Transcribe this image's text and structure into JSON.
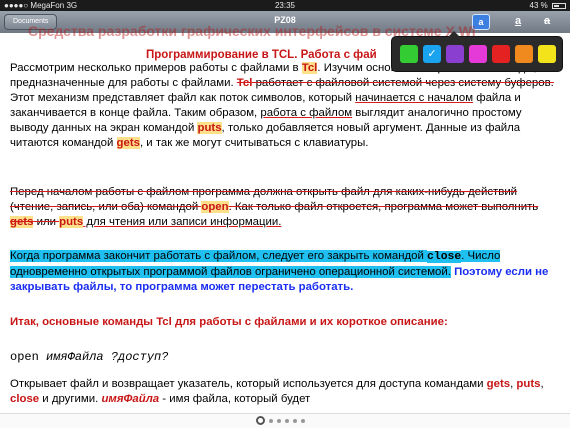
{
  "status": {
    "carrier": "MegaFon",
    "network": "3G",
    "time": "23:35",
    "battery": "43 %"
  },
  "toolbar": {
    "documents": "Documents",
    "title": "PZ08",
    "tool_highlight": "a",
    "tool_underline": "a",
    "tool_strike": "a"
  },
  "palette": {
    "colors": [
      "#33cc33",
      "#1aa4f0",
      "#8a3fd0",
      "#e53ad8",
      "#e52222",
      "#f08a1f",
      "#f2e31a"
    ],
    "selected_mark": "✓"
  },
  "document": {
    "header_overlay": "Средства разработки графических интерфейсов в системе X Wi",
    "heading": "Программирование в TCL. Работа с фай",
    "p1": {
      "a": "Рассмотрим несколько примеров работы с файлами в ",
      "tcl": "Tcl",
      "b": ". Изучим основные встроенные команды, предназначенные для работы с файлами. ",
      "tcl2": "Tcl",
      "c": " работает с файловой системой через систему буферов.",
      "d": " Этот механизм представляет файл как поток символов, который ",
      "e": "начинается с началом",
      "f": " файла и заканчивается в конце файла. Таким образом, ",
      "g": "работа с файлом",
      "h": " выглядит аналогично простому выводу данных на экран командой ",
      "puts": "puts",
      "i": ", только добавляется новый аргумент. Данные из файла читаются командой ",
      "gets": "gets",
      "j": ", и так же могут считываться с клавиатуры."
    },
    "p2": {
      "a": "Перед началом работы с файлом программа должна открыть файл для каких-нибудь действий (чтение, запись, или оба) командой ",
      "open": "open",
      "b": ". Как только файл откроется, программа может выполнить ",
      "gets": "gets",
      "c": " или ",
      "puts": "puts",
      "d": " для чтения или записи информации."
    },
    "p3": {
      "a": "Когда программа закончит работать с файлом, следует его закрыть командой ",
      "close": "close",
      "b": ". Число одновременно открытых программой файлов ограничено операционной системой.",
      "c": " Поэтому если не закрывать файлы, то программа может перестать работать."
    },
    "p4": "Итак, основные команды Tcl для работы с файлами и их короткое описание:",
    "p5": {
      "cmd": "open ",
      "args": "имяФайла ?доступ?"
    },
    "p6": {
      "a": "Открывает файл и возвращает указатель, который используется для доступа командами ",
      "gets": "gets",
      "s1": ", ",
      "puts": "puts",
      "s2": ", ",
      "close": "close",
      "b": " и другими. ",
      "fname": "имяФайла",
      "c": " - имя файла, который будет"
    }
  },
  "pager": {
    "pages": 6,
    "current": 1
  }
}
